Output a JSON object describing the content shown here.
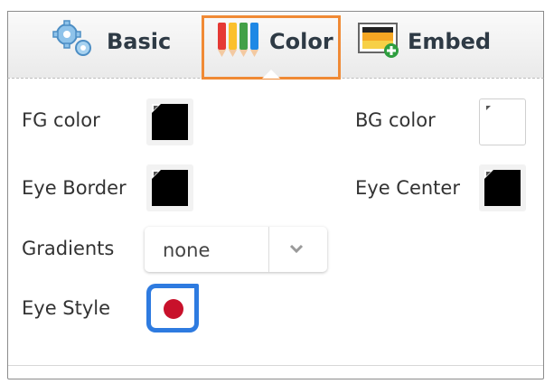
{
  "tabs": {
    "basic": {
      "label": "Basic",
      "icon": "gears-icon"
    },
    "color": {
      "label": "Color",
      "icon": "color-pencils-icon",
      "active": true
    },
    "embed": {
      "label": "Embed",
      "icon": "embed-image-icon"
    }
  },
  "fields": {
    "fg_color": {
      "label": "FG color",
      "value": "#000000"
    },
    "bg_color": {
      "label": "BG color",
      "value": "#ffffff"
    },
    "eye_border": {
      "label": "Eye Border",
      "value": "#000000"
    },
    "eye_center": {
      "label": "Eye Center",
      "value": "#000000"
    },
    "gradients": {
      "label": "Gradients",
      "value": "none"
    },
    "eye_style": {
      "label": "Eye Style",
      "dot_color": "#c8112b",
      "frame_color": "#2e7be0"
    }
  },
  "colors": {
    "highlight": "#f08a35",
    "tab_text": "#2e3a45",
    "label_text": "#333333"
  }
}
